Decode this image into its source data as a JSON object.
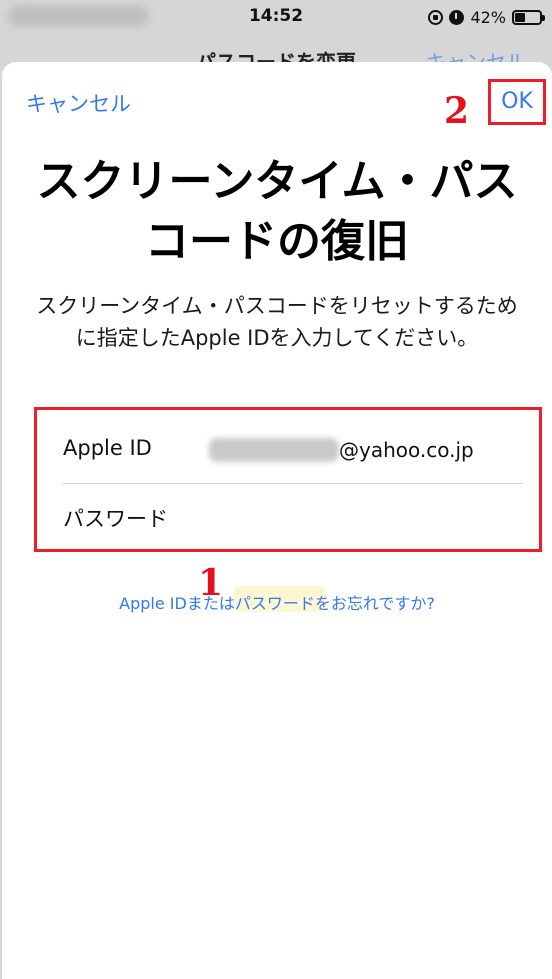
{
  "status_bar": {
    "time": "14:52",
    "battery": "42%",
    "battery_level": 0.42
  },
  "background_nav": {
    "title": "パスコードを変更",
    "cancel": "キャンセル"
  },
  "sheet": {
    "cancel_label": "キャンセル",
    "ok_label": "OK",
    "title": "スクリーンタイム・パスコードの復旧",
    "description": "スクリーンタイム・パスコードをリセットするために指定したApple IDを入力してください。",
    "apple_id_label": "Apple ID",
    "apple_id_domain": "@yahoo.co.jp",
    "password_label": "パスワード",
    "forgot_link": "Apple IDまたはパスワードをお忘れですか?"
  },
  "annotations": {
    "marker_1": "1",
    "marker_2": "2"
  },
  "colors": {
    "accent": "#3478f6",
    "highlight": "#f01c28",
    "marker": "#e5101c"
  }
}
